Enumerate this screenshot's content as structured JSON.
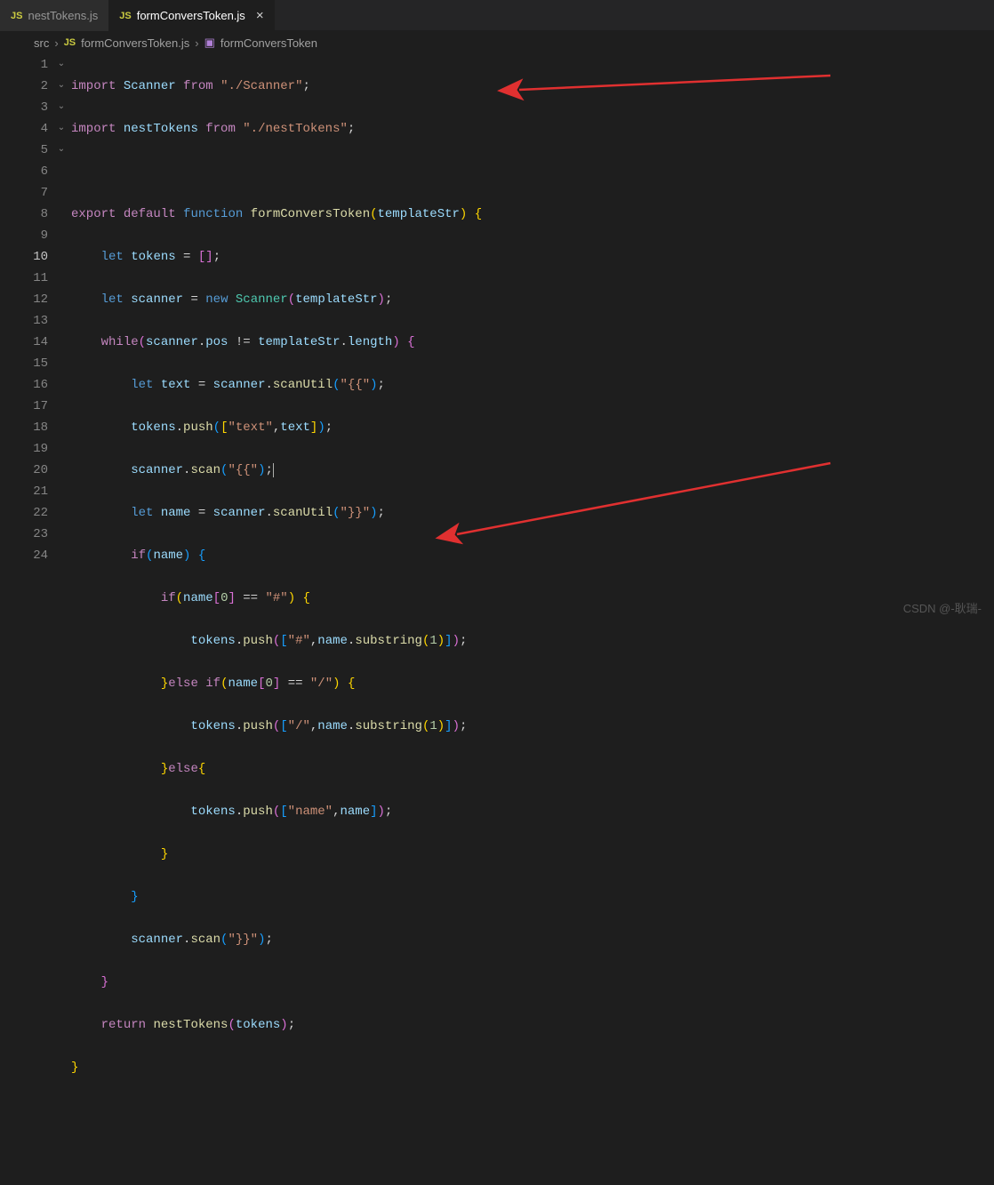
{
  "tabs": [
    {
      "icon": "JS",
      "label": "nestTokens.js",
      "active": false
    },
    {
      "icon": "JS",
      "label": "formConversToken.js",
      "active": true
    }
  ],
  "breadcrumbs": {
    "root": "src",
    "fileIcon": "JS",
    "file": "formConversToken.js",
    "symbol": "formConversToken"
  },
  "totalLines": 24,
  "activeLineNum": 10,
  "code": {
    "l1": {
      "import": "import",
      "Scanner": "Scanner",
      "from": "from",
      "path": "\"./Scanner\"",
      "semi": ";"
    },
    "l2": {
      "import": "import",
      "nestTokens": "nestTokens",
      "from": "from",
      "path": "\"./nestTokens\"",
      "semi": ";"
    },
    "l4": {
      "export": "export",
      "default": "default",
      "function": "function",
      "name": "formConversToken",
      "param": "templateStr"
    },
    "l5": {
      "let": "let",
      "tokens": "tokens",
      "eq": " = ",
      "val": "[]",
      "semi": ";"
    },
    "l6": {
      "let": "let",
      "scanner": "scanner",
      "eq": " = ",
      "new": "new",
      "Scanner": "Scanner",
      "arg": "templateStr"
    },
    "l7": {
      "while": "while",
      "scanner": "scanner",
      "pos": "pos",
      "op": " != ",
      "templateStr": "templateStr",
      "length": "length"
    },
    "l8": {
      "let": "let",
      "text": "text",
      "eq": " = ",
      "scanner": "scanner",
      "fn": "scanUtil",
      "arg": "\"{{\""
    },
    "l9": {
      "tokens": "tokens",
      "push": "push",
      "s": "\"text\"",
      "text": "text"
    },
    "l10": {
      "scanner": "scanner",
      "scan": "scan",
      "arg": "\"{{\""
    },
    "l11": {
      "let": "let",
      "name": "name",
      "eq": " = ",
      "scanner": "scanner",
      "fn": "scanUtil",
      "arg": "\"}}\""
    },
    "l12": {
      "if": "if",
      "name": "name"
    },
    "l13": {
      "if": "if",
      "name": "name",
      "zero": "0",
      "eq": " == ",
      "hash": "\"#\""
    },
    "l14": {
      "tokens": "tokens",
      "push": "push",
      "hash": "\"#\"",
      "name": "name",
      "substring": "substring",
      "one": "1"
    },
    "l15": {
      "else": "else",
      "if": "if",
      "name": "name",
      "zero": "0",
      "eq": " == ",
      "slash": "\"/\""
    },
    "l16": {
      "tokens": "tokens",
      "push": "push",
      "slash": "\"/\"",
      "name": "name",
      "substring": "substring",
      "one": "1"
    },
    "l17": {
      "else": "else"
    },
    "l18": {
      "tokens": "tokens",
      "push": "push",
      "s": "\"name\"",
      "name": "name"
    },
    "l21": {
      "scanner": "scanner",
      "scan": "scan",
      "arg": "\"}}\""
    },
    "l23": {
      "return": "return",
      "nestTokens": "nestTokens",
      "tokens": "tokens"
    }
  },
  "watermark": "CSDN @-耿瑞-"
}
